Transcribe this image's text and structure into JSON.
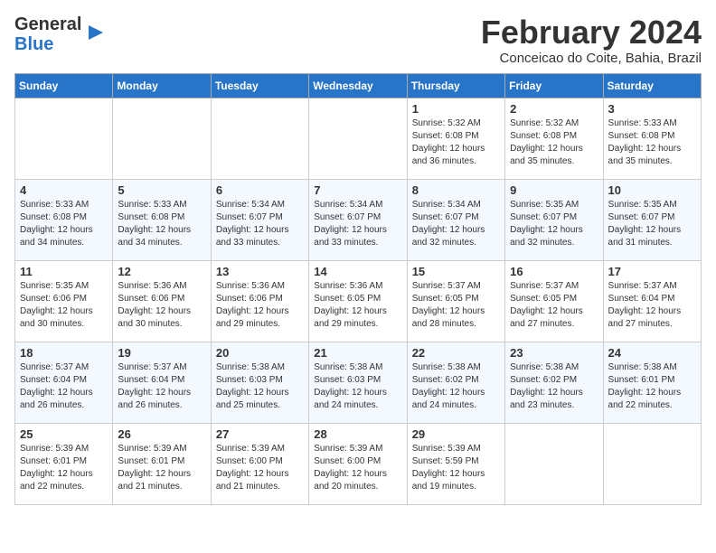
{
  "header": {
    "logo_general": "General",
    "logo_blue": "Blue",
    "month_year": "February 2024",
    "location": "Conceicao do Coite, Bahia, Brazil"
  },
  "days_of_week": [
    "Sunday",
    "Monday",
    "Tuesday",
    "Wednesday",
    "Thursday",
    "Friday",
    "Saturday"
  ],
  "weeks": [
    [
      {
        "day": "",
        "info": ""
      },
      {
        "day": "",
        "info": ""
      },
      {
        "day": "",
        "info": ""
      },
      {
        "day": "",
        "info": ""
      },
      {
        "day": "1",
        "info": "Sunrise: 5:32 AM\nSunset: 6:08 PM\nDaylight: 12 hours\nand 36 minutes."
      },
      {
        "day": "2",
        "info": "Sunrise: 5:32 AM\nSunset: 6:08 PM\nDaylight: 12 hours\nand 35 minutes."
      },
      {
        "day": "3",
        "info": "Sunrise: 5:33 AM\nSunset: 6:08 PM\nDaylight: 12 hours\nand 35 minutes."
      }
    ],
    [
      {
        "day": "4",
        "info": "Sunrise: 5:33 AM\nSunset: 6:08 PM\nDaylight: 12 hours\nand 34 minutes."
      },
      {
        "day": "5",
        "info": "Sunrise: 5:33 AM\nSunset: 6:08 PM\nDaylight: 12 hours\nand 34 minutes."
      },
      {
        "day": "6",
        "info": "Sunrise: 5:34 AM\nSunset: 6:07 PM\nDaylight: 12 hours\nand 33 minutes."
      },
      {
        "day": "7",
        "info": "Sunrise: 5:34 AM\nSunset: 6:07 PM\nDaylight: 12 hours\nand 33 minutes."
      },
      {
        "day": "8",
        "info": "Sunrise: 5:34 AM\nSunset: 6:07 PM\nDaylight: 12 hours\nand 32 minutes."
      },
      {
        "day": "9",
        "info": "Sunrise: 5:35 AM\nSunset: 6:07 PM\nDaylight: 12 hours\nand 32 minutes."
      },
      {
        "day": "10",
        "info": "Sunrise: 5:35 AM\nSunset: 6:07 PM\nDaylight: 12 hours\nand 31 minutes."
      }
    ],
    [
      {
        "day": "11",
        "info": "Sunrise: 5:35 AM\nSunset: 6:06 PM\nDaylight: 12 hours\nand 30 minutes."
      },
      {
        "day": "12",
        "info": "Sunrise: 5:36 AM\nSunset: 6:06 PM\nDaylight: 12 hours\nand 30 minutes."
      },
      {
        "day": "13",
        "info": "Sunrise: 5:36 AM\nSunset: 6:06 PM\nDaylight: 12 hours\nand 29 minutes."
      },
      {
        "day": "14",
        "info": "Sunrise: 5:36 AM\nSunset: 6:05 PM\nDaylight: 12 hours\nand 29 minutes."
      },
      {
        "day": "15",
        "info": "Sunrise: 5:37 AM\nSunset: 6:05 PM\nDaylight: 12 hours\nand 28 minutes."
      },
      {
        "day": "16",
        "info": "Sunrise: 5:37 AM\nSunset: 6:05 PM\nDaylight: 12 hours\nand 27 minutes."
      },
      {
        "day": "17",
        "info": "Sunrise: 5:37 AM\nSunset: 6:04 PM\nDaylight: 12 hours\nand 27 minutes."
      }
    ],
    [
      {
        "day": "18",
        "info": "Sunrise: 5:37 AM\nSunset: 6:04 PM\nDaylight: 12 hours\nand 26 minutes."
      },
      {
        "day": "19",
        "info": "Sunrise: 5:37 AM\nSunset: 6:04 PM\nDaylight: 12 hours\nand 26 minutes."
      },
      {
        "day": "20",
        "info": "Sunrise: 5:38 AM\nSunset: 6:03 PM\nDaylight: 12 hours\nand 25 minutes."
      },
      {
        "day": "21",
        "info": "Sunrise: 5:38 AM\nSunset: 6:03 PM\nDaylight: 12 hours\nand 24 minutes."
      },
      {
        "day": "22",
        "info": "Sunrise: 5:38 AM\nSunset: 6:02 PM\nDaylight: 12 hours\nand 24 minutes."
      },
      {
        "day": "23",
        "info": "Sunrise: 5:38 AM\nSunset: 6:02 PM\nDaylight: 12 hours\nand 23 minutes."
      },
      {
        "day": "24",
        "info": "Sunrise: 5:38 AM\nSunset: 6:01 PM\nDaylight: 12 hours\nand 22 minutes."
      }
    ],
    [
      {
        "day": "25",
        "info": "Sunrise: 5:39 AM\nSunset: 6:01 PM\nDaylight: 12 hours\nand 22 minutes."
      },
      {
        "day": "26",
        "info": "Sunrise: 5:39 AM\nSunset: 6:01 PM\nDaylight: 12 hours\nand 21 minutes."
      },
      {
        "day": "27",
        "info": "Sunrise: 5:39 AM\nSunset: 6:00 PM\nDaylight: 12 hours\nand 21 minutes."
      },
      {
        "day": "28",
        "info": "Sunrise: 5:39 AM\nSunset: 6:00 PM\nDaylight: 12 hours\nand 20 minutes."
      },
      {
        "day": "29",
        "info": "Sunrise: 5:39 AM\nSunset: 5:59 PM\nDaylight: 12 hours\nand 19 minutes."
      },
      {
        "day": "",
        "info": ""
      },
      {
        "day": "",
        "info": ""
      }
    ]
  ]
}
